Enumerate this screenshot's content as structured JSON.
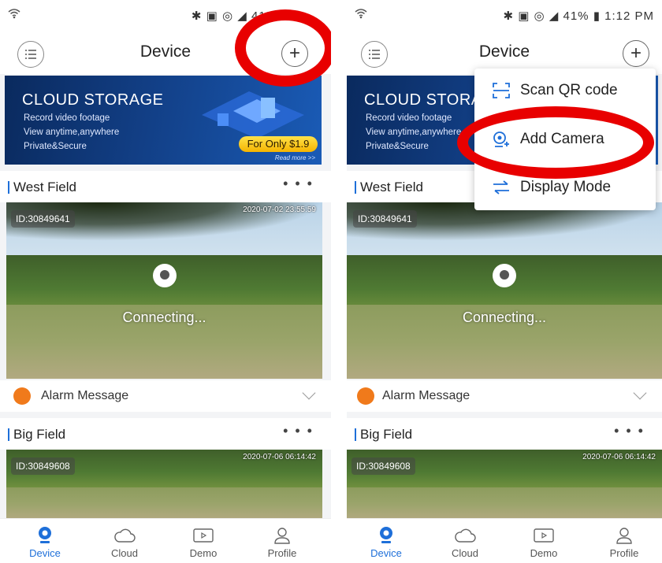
{
  "statusbar": {
    "wifi_icon": "wifi-icon",
    "right_text": "41%",
    "time": "1:12 PM"
  },
  "appbar": {
    "title": "Device"
  },
  "banner": {
    "title": "CLOUD STORAGE",
    "line1": "Record video footage",
    "line2": "View anytime,anywhere",
    "line3": "Private&Secure",
    "price": "For Only $1.9",
    "read_more": "Read more >>"
  },
  "cameras": [
    {
      "name": "West Field",
      "id": "ID:30849641",
      "timestamp": "2020-07-02  23:55:59",
      "status": "Connecting..."
    },
    {
      "name": "Big Field",
      "id": "ID:30849608",
      "timestamp": "2020-07-06  06:14:42"
    }
  ],
  "alarm": {
    "label": "Alarm Message"
  },
  "more_label": "• • •",
  "tabs": [
    {
      "label": "Device",
      "icon": "device-icon"
    },
    {
      "label": "Cloud",
      "icon": "cloud-icon"
    },
    {
      "label": "Demo",
      "icon": "play-icon"
    },
    {
      "label": "Profile",
      "icon": "profile-icon"
    }
  ],
  "popup_menu": [
    {
      "label": "Scan QR code",
      "icon": "scan-icon"
    },
    {
      "label": "Add Camera",
      "icon": "add-camera-icon"
    },
    {
      "label": "Display Mode",
      "icon": "swap-icon"
    }
  ],
  "colors": {
    "accent": "#1e6fd9",
    "highlight_ring": "#e80000",
    "alarm": "#f07a1b"
  }
}
